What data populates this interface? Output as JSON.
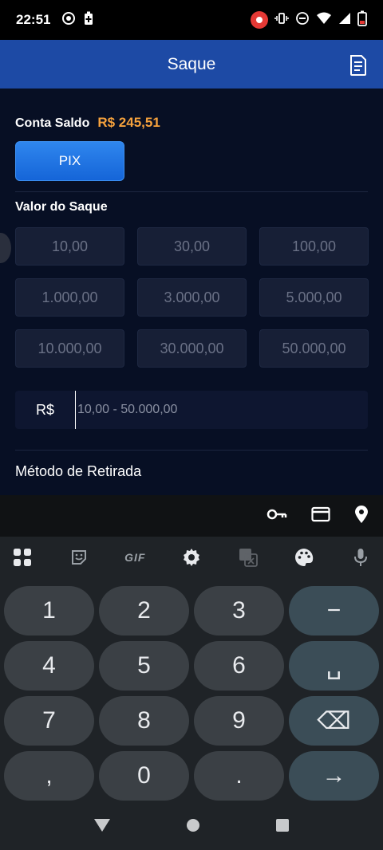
{
  "status_bar": {
    "time": "22:51"
  },
  "header": {
    "title": "Saque",
    "document_icon": "document-icon"
  },
  "balance": {
    "label": "Conta Saldo",
    "value": "R$ 245,51"
  },
  "pix_button": "PIX",
  "withdraw_section": {
    "label": "Valor do Saque",
    "amounts": [
      "10,00",
      "30,00",
      "100,00",
      "1.000,00",
      "3.000,00",
      "5.000,00",
      "10.000,00",
      "30.000,00",
      "50.000,00"
    ]
  },
  "amount_input": {
    "currency": "R$",
    "placeholder": "10,00 - 50.000,00",
    "value": ""
  },
  "method_section": {
    "label": "Método de Retirada"
  },
  "keyboard": {
    "keys": [
      "1",
      "2",
      "3",
      "−",
      "4",
      "5",
      "6",
      "␣",
      "7",
      "8",
      "9",
      "⌫",
      ",",
      "0",
      ".",
      "→"
    ]
  }
}
